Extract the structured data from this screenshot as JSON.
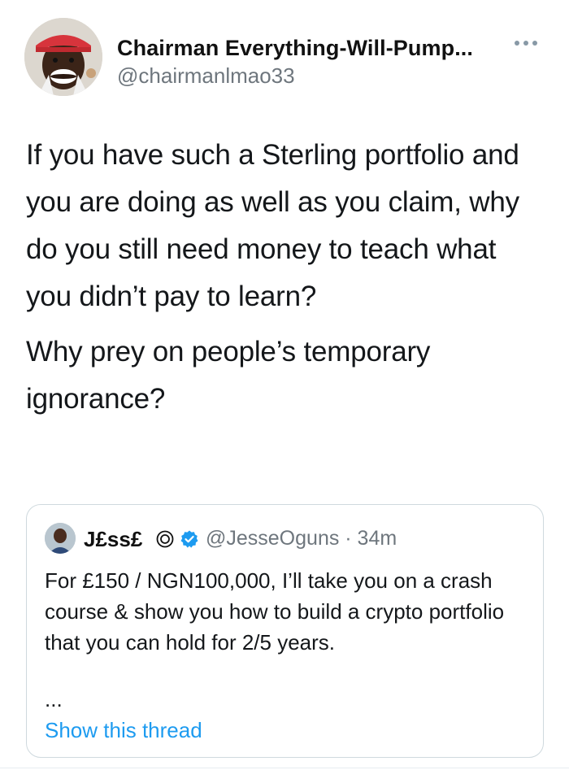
{
  "tweet": {
    "author": {
      "display_name": "Chairman Everything-Will-Pump...",
      "handle": "@chairmanlmao33",
      "avatar_icon": "profile-photo"
    },
    "more_icon": "more-options-icon",
    "paragraphs": [
      "If you have such a Sterling portfolio and you are doing as well as you claim, why do you still need money to teach what you didn’t pay to learn?",
      "Why prey on people’s temporary ignorance?"
    ]
  },
  "quoted_tweet": {
    "author": {
      "display_name": "J£ss£",
      "handle_time": "@JesseOguns · 34m",
      "avatar_icon": "profile-photo",
      "badge_icons": [
        "circle-symbol-icon",
        "verified-badge-icon"
      ]
    },
    "text": "For £150 / NGN100,000, I’ll take you on a crash course & show you how to build a crypto portfolio that you can hold for 2/5 years.",
    "ellipsis": "...",
    "show_thread_label": "Show this thread"
  },
  "colors": {
    "link": "#1d9bf0",
    "verified": "#1d9bf0",
    "secondary_text": "#6e767d",
    "border": "#cfd9de"
  }
}
